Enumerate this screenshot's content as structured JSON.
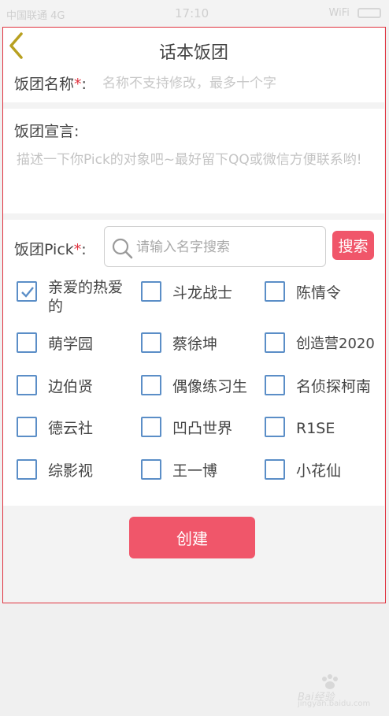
{
  "statusbar": {
    "left": "中国联通 4G",
    "time": "17:10",
    "right": "WiFi"
  },
  "header": {
    "title": "话本饭团"
  },
  "form": {
    "name_label": "饭团名称",
    "required_mark": "*",
    "name_colon": ":",
    "name_placeholder": "名称不支持修改，最多十个字",
    "manifesto_label": "饭团宣言:",
    "manifesto_placeholder": "描述一下你Pick的对象吧~最好留下QQ或微信方便联系哟!",
    "pick_label": "饭团Pick",
    "pick_colon": ":",
    "search_placeholder": "请输入名字搜索",
    "search_button": "搜索",
    "options": [
      {
        "label": "亲爱的热爱的",
        "checked": true
      },
      {
        "label": "斗龙战士",
        "checked": false
      },
      {
        "label": "陈情令",
        "checked": false
      },
      {
        "label": "萌学园",
        "checked": false
      },
      {
        "label": "蔡徐坤",
        "checked": false
      },
      {
        "label": "创造营2020",
        "checked": false
      },
      {
        "label": "边伯贤",
        "checked": false
      },
      {
        "label": "偶像练习生",
        "checked": false
      },
      {
        "label": "名侦探柯南",
        "checked": false
      },
      {
        "label": "德云社",
        "checked": false
      },
      {
        "label": "凹凸世界",
        "checked": false
      },
      {
        "label": "R1SE",
        "checked": false
      },
      {
        "label": "综影视",
        "checked": false
      },
      {
        "label": "王一博",
        "checked": false
      },
      {
        "label": "小花仙",
        "checked": false
      }
    ],
    "create_button": "创建"
  },
  "watermark": {
    "text": "Bai经验",
    "url": "jingyan.baidu.com"
  },
  "colors": {
    "accent": "#f0566a",
    "border_highlight": "#e0333f",
    "checkbox": "#5b8ec7"
  }
}
